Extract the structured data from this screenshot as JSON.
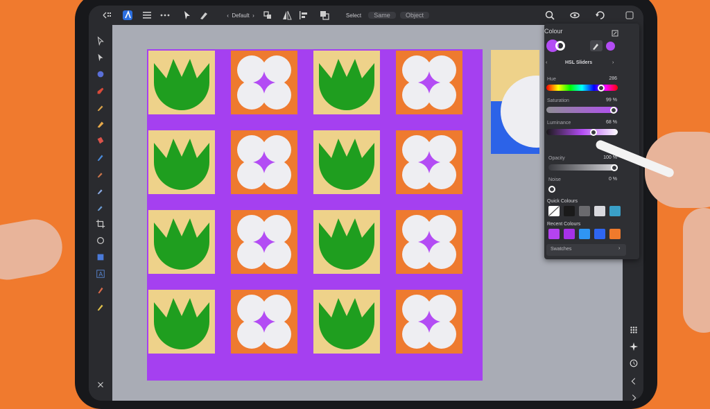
{
  "toolbar": {
    "preset_label": "Default",
    "select_label": "Select",
    "same_label": "Same",
    "object_label": "Object"
  },
  "colour_panel": {
    "title": "Colour",
    "mode_label": "HSL Sliders",
    "hue_label": "Hue",
    "hue_value": "286",
    "saturation_label": "Saturation",
    "saturation_value": "99 %",
    "luminance_label": "Luminance",
    "luminance_value": "68 %",
    "opacity_label": "Opacity",
    "opacity_value": "100 %",
    "noise_label": "Noise",
    "noise_value": "0 %",
    "quick_colours_label": "Quick Colours",
    "recent_colours_label": "Recent Colours",
    "swatches_label": "Swatches",
    "levels": {
      "hue": 0.794,
      "saturation": 0.99,
      "luminance": 0.68,
      "opacity": 1.0,
      "noise": 0.0
    },
    "quick_colours": [
      "none",
      "#1a1a1a",
      "#6a6a6e",
      "#d9d9de",
      "#3aa0c8"
    ],
    "recent_colours": [
      "#b543f0",
      "#a632e8",
      "#2f95f2",
      "#2f66f2",
      "#ef7a2c"
    ]
  },
  "colors": {
    "purple": "#a540f0",
    "orange": "#ee7a2f",
    "cream": "#eed28a",
    "green": "#1f9e1f",
    "white": "#eeeef2",
    "canvas_gray": "#a9acb5",
    "accent": "#b34cf4"
  },
  "icons": {
    "tools": [
      "move-icon",
      "node-icon",
      "pen-icon",
      "pencil-icon",
      "brush-icon",
      "erase-icon",
      "fill-icon",
      "gradient-icon",
      "eyedropper-icon",
      "transparency-icon",
      "crop-icon",
      "ellipse-icon",
      "shape-icon",
      "text-icon",
      "vector-brush-icon",
      "pencil-tool-icon"
    ],
    "right": [
      "colour-icon",
      "stroke-icon",
      "layers-icon",
      "brushes-icon",
      "appearance-icon",
      "transform-icon",
      "history-icon",
      "grid-icon"
    ]
  }
}
